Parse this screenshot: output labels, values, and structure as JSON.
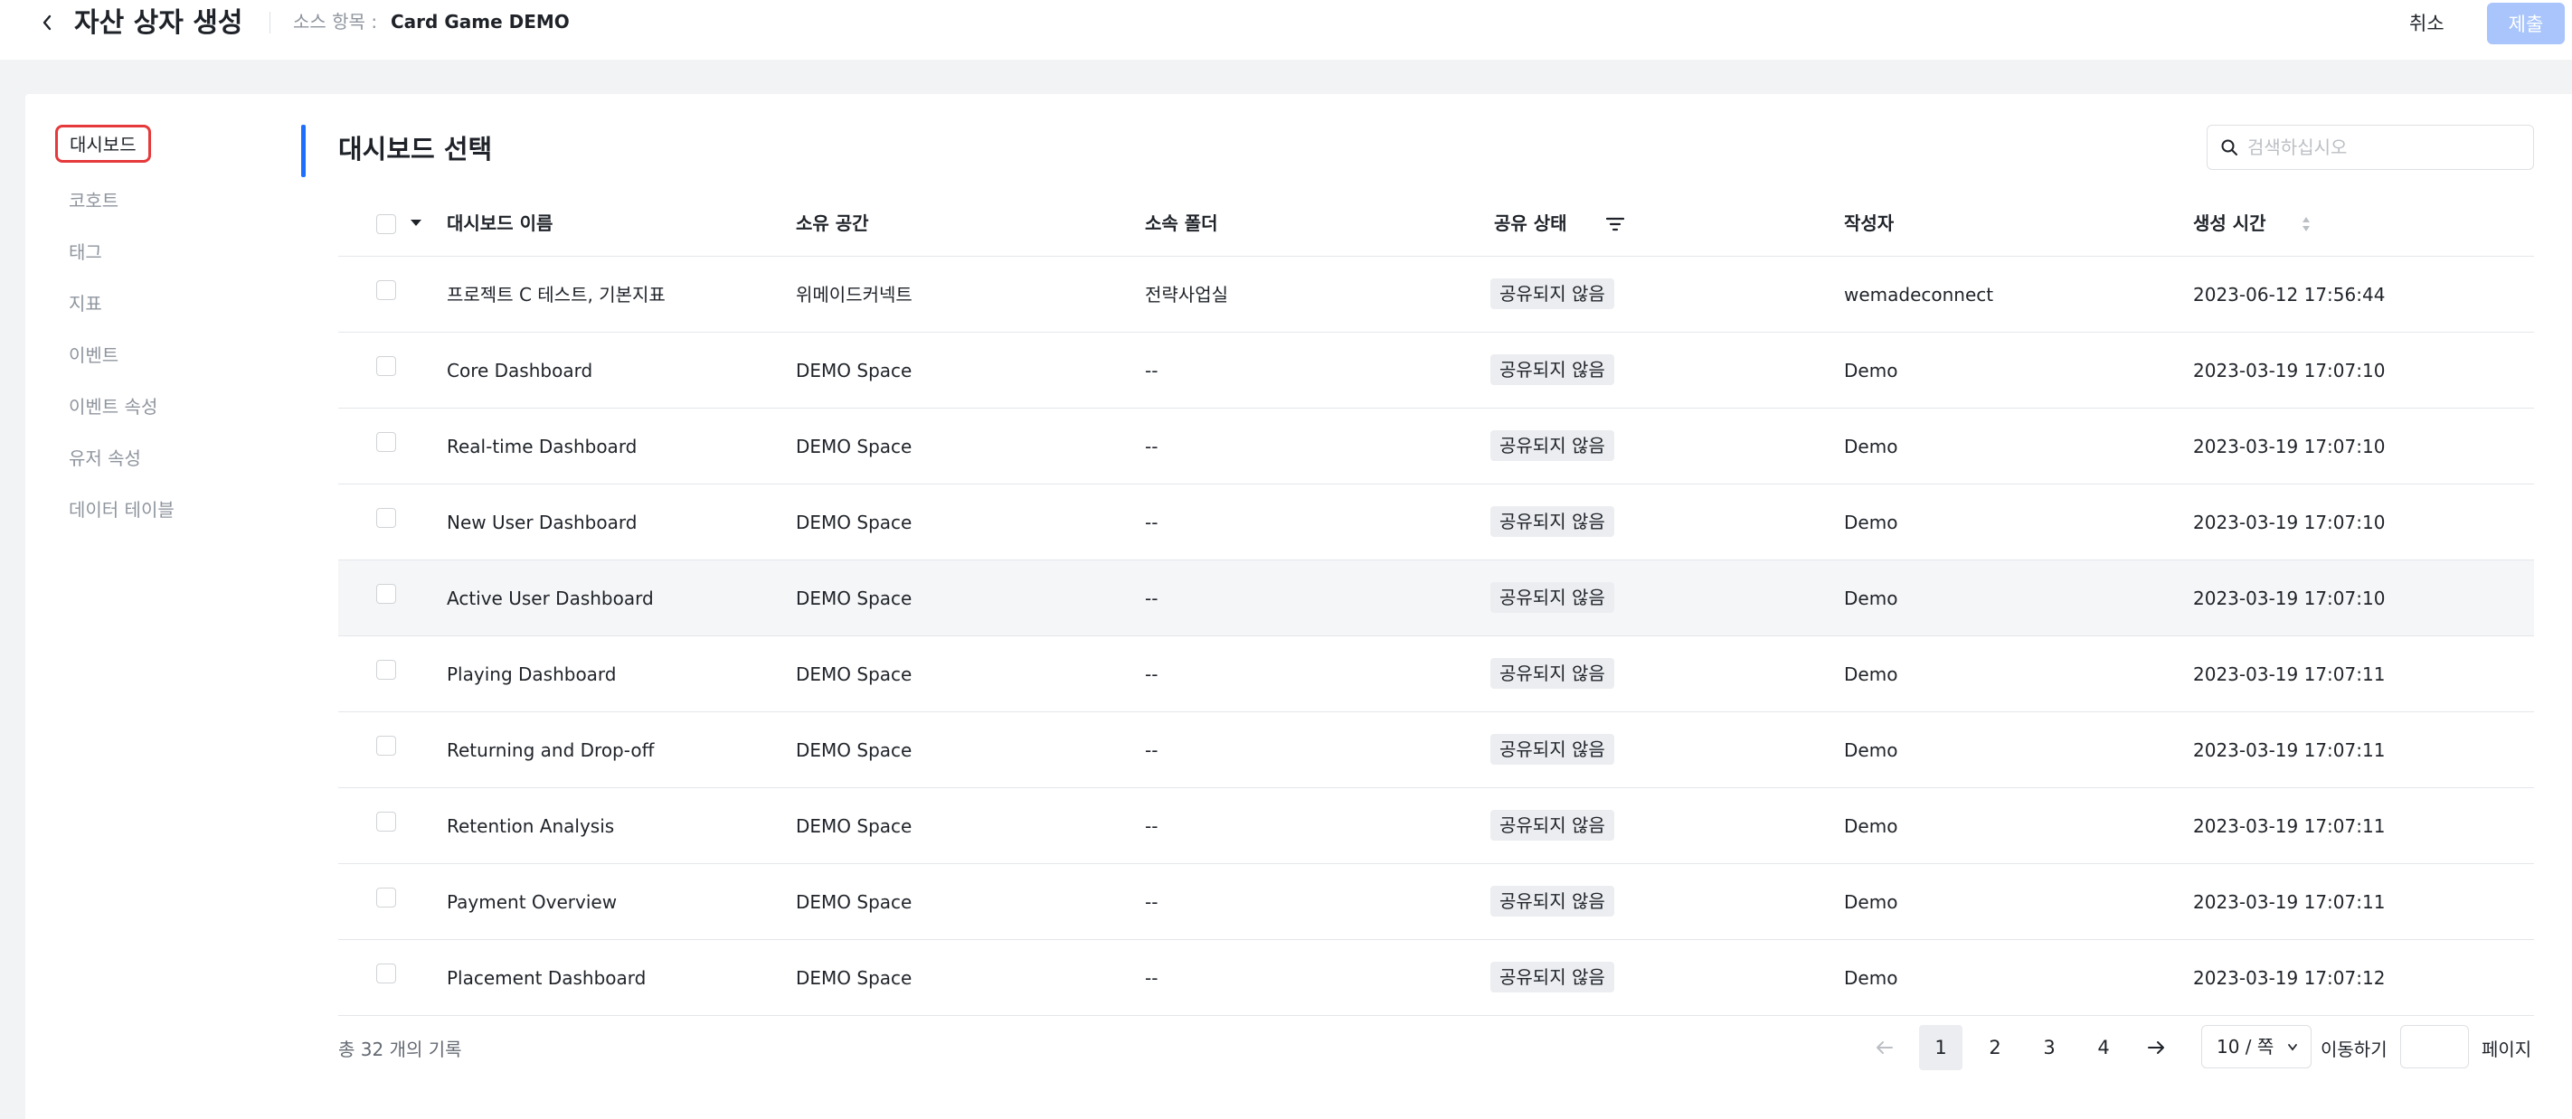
{
  "header": {
    "back_icon": "chevron-left-icon",
    "title": "자산 상자 생성",
    "source_label": "소스 항목 :",
    "source_value": "Card Game DEMO",
    "cancel_label": "취소",
    "submit_label": "제출"
  },
  "sidebar": {
    "items": [
      {
        "label": "대시보드",
        "active": true
      },
      {
        "label": "코호트"
      },
      {
        "label": "태그"
      },
      {
        "label": "지표"
      },
      {
        "label": "이벤트"
      },
      {
        "label": "이벤트 속성"
      },
      {
        "label": "유저 속성"
      },
      {
        "label": "데이터 테이블"
      }
    ]
  },
  "content": {
    "title": "대시보드 선택",
    "search_placeholder": "검색하십시오"
  },
  "table": {
    "columns": [
      "대시보드 이름",
      "소유 공간",
      "소속 폴더",
      "공유 상태",
      "작성자",
      "생성 시간"
    ],
    "rows": [
      {
        "name": "프로젝트 C 테스트, 기본지표",
        "space": "위메이드커넥트",
        "folder": "전략사업실",
        "share": "공유되지 않음",
        "author": "wemadeconnect",
        "created": "2023-06-12 17:56:44"
      },
      {
        "name": "Core Dashboard",
        "space": "DEMO Space",
        "folder": "--",
        "share": "공유되지 않음",
        "author": "Demo",
        "created": "2023-03-19 17:07:10"
      },
      {
        "name": "Real-time Dashboard",
        "space": "DEMO Space",
        "folder": "--",
        "share": "공유되지 않음",
        "author": "Demo",
        "created": "2023-03-19 17:07:10"
      },
      {
        "name": "New User Dashboard",
        "space": "DEMO Space",
        "folder": "--",
        "share": "공유되지 않음",
        "author": "Demo",
        "created": "2023-03-19 17:07:10"
      },
      {
        "name": "Active User Dashboard",
        "space": "DEMO Space",
        "folder": "--",
        "share": "공유되지 않음",
        "author": "Demo",
        "created": "2023-03-19 17:07:10"
      },
      {
        "name": "Playing Dashboard",
        "space": "DEMO Space",
        "folder": "--",
        "share": "공유되지 않음",
        "author": "Demo",
        "created": "2023-03-19 17:07:11"
      },
      {
        "name": "Returning and Drop-off",
        "space": "DEMO Space",
        "folder": "--",
        "share": "공유되지 않음",
        "author": "Demo",
        "created": "2023-03-19 17:07:11"
      },
      {
        "name": "Retention Analysis",
        "space": "DEMO Space",
        "folder": "--",
        "share": "공유되지 않음",
        "author": "Demo",
        "created": "2023-03-19 17:07:11"
      },
      {
        "name": "Payment Overview",
        "space": "DEMO Space",
        "folder": "--",
        "share": "공유되지 않음",
        "author": "Demo",
        "created": "2023-03-19 17:07:11"
      },
      {
        "name": "Placement Dashboard",
        "space": "DEMO Space",
        "folder": "--",
        "share": "공유되지 않음",
        "author": "Demo",
        "created": "2023-03-19 17:07:12"
      }
    ]
  },
  "footer": {
    "total_text": "총 32 개의 기록",
    "pages": [
      "1",
      "2",
      "3",
      "4"
    ],
    "current_page": "1",
    "prev_icon": "arrow-left-icon",
    "next_icon": "arrow-right-icon",
    "page_size": "10 / 쪽",
    "goto_label": "이동하기",
    "goto_suffix": "페이지"
  },
  "colors": {
    "accent": "#1f6fff",
    "submit_disabled": "#a9c5fb",
    "highlight_border": "#e5393b"
  }
}
